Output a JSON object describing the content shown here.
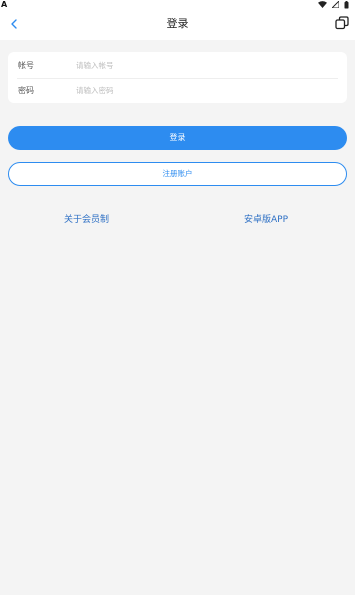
{
  "status_bar": {
    "left_glyph": "A",
    "icons": [
      "wifi-icon",
      "signal-icon",
      "battery-icon"
    ]
  },
  "header": {
    "title": "登录",
    "back_icon": "chevron-left-icon",
    "right_icon": "window-switch-icon"
  },
  "form": {
    "account": {
      "label": "帐号",
      "placeholder": "请输入帐号",
      "value": ""
    },
    "password": {
      "label": "密码",
      "placeholder": "请输入密码",
      "value": ""
    }
  },
  "buttons": {
    "login_label": "登录",
    "register_label": "注册账户"
  },
  "links": {
    "about_membership": "关于会员制",
    "android_app": "安卓版APP"
  },
  "colors": {
    "accent": "#2d8cf0",
    "link": "#2d6fc4",
    "background": "#f4f4f4"
  }
}
